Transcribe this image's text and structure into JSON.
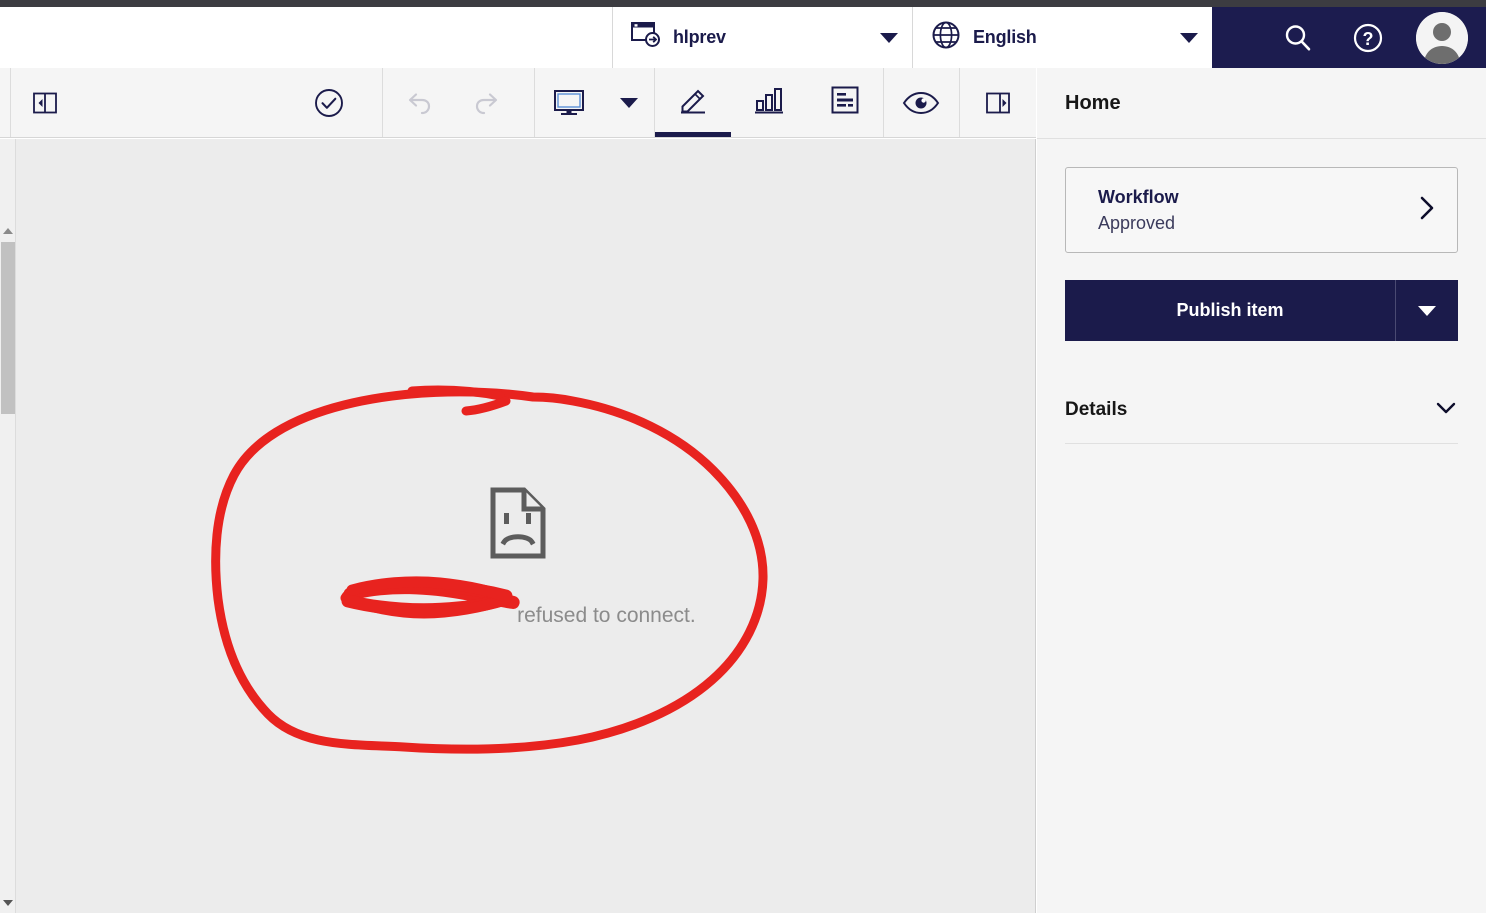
{
  "header": {
    "site_selector": {
      "icon": "site-preview-icon",
      "label": "hlprev",
      "caret": "chevron-down-icon"
    },
    "language_selector": {
      "icon": "globe-icon",
      "label": "English",
      "caret": "chevron-down-icon"
    },
    "actions": [
      {
        "name": "search-icon",
        "title": "Search"
      },
      {
        "name": "help-icon",
        "title": "Help"
      },
      {
        "name": "avatar",
        "title": "User profile"
      }
    ],
    "accent_navy": "#1c1c4f"
  },
  "toolbar": {
    "left_panel_toggle": {
      "icon": "collapse-left-panel-icon",
      "title": "Collapse panel"
    },
    "save": {
      "icon": "check-circle-icon",
      "title": "Save"
    },
    "undo": {
      "icon": "undo-icon",
      "title": "Undo",
      "enabled": false
    },
    "redo": {
      "icon": "redo-icon",
      "title": "Redo",
      "enabled": false
    },
    "device": {
      "icon": "monitor-icon",
      "title": "Device",
      "caret": "chevron-down-icon"
    },
    "tabs": [
      {
        "icon": "pencil-icon",
        "title": "Edit",
        "active": true
      },
      {
        "icon": "bar-chart-icon",
        "title": "Analytics",
        "active": false
      },
      {
        "icon": "content-list-icon",
        "title": "Content",
        "active": false
      }
    ],
    "preview": {
      "icon": "eye-icon",
      "title": "Preview"
    },
    "right_panel_toggle": {
      "icon": "expand-right-panel-icon",
      "title": "Expand panel"
    }
  },
  "content": {
    "error_icon": "sad-document-icon",
    "error_message": "refused to connect.",
    "redacted_host": "",
    "background": "#ececec",
    "scrollbar": {
      "up_arrow": "scroll-up-arrow-icon",
      "down_arrow": "scroll-down-arrow-icon"
    },
    "annotation": {
      "type": "freehand-ink",
      "color": "#e8231f",
      "shapes": [
        "ellipse-circle",
        "strikethrough-scribble"
      ]
    }
  },
  "panel": {
    "title": "Home",
    "workflow": {
      "label": "Workflow",
      "status": "Approved",
      "chevron": "chevron-right-icon"
    },
    "publish": {
      "label": "Publish item",
      "caret": "chevron-down-icon",
      "color": "#1b1b4b"
    },
    "details": {
      "label": "Details",
      "chevron": "chevron-down-icon"
    }
  }
}
